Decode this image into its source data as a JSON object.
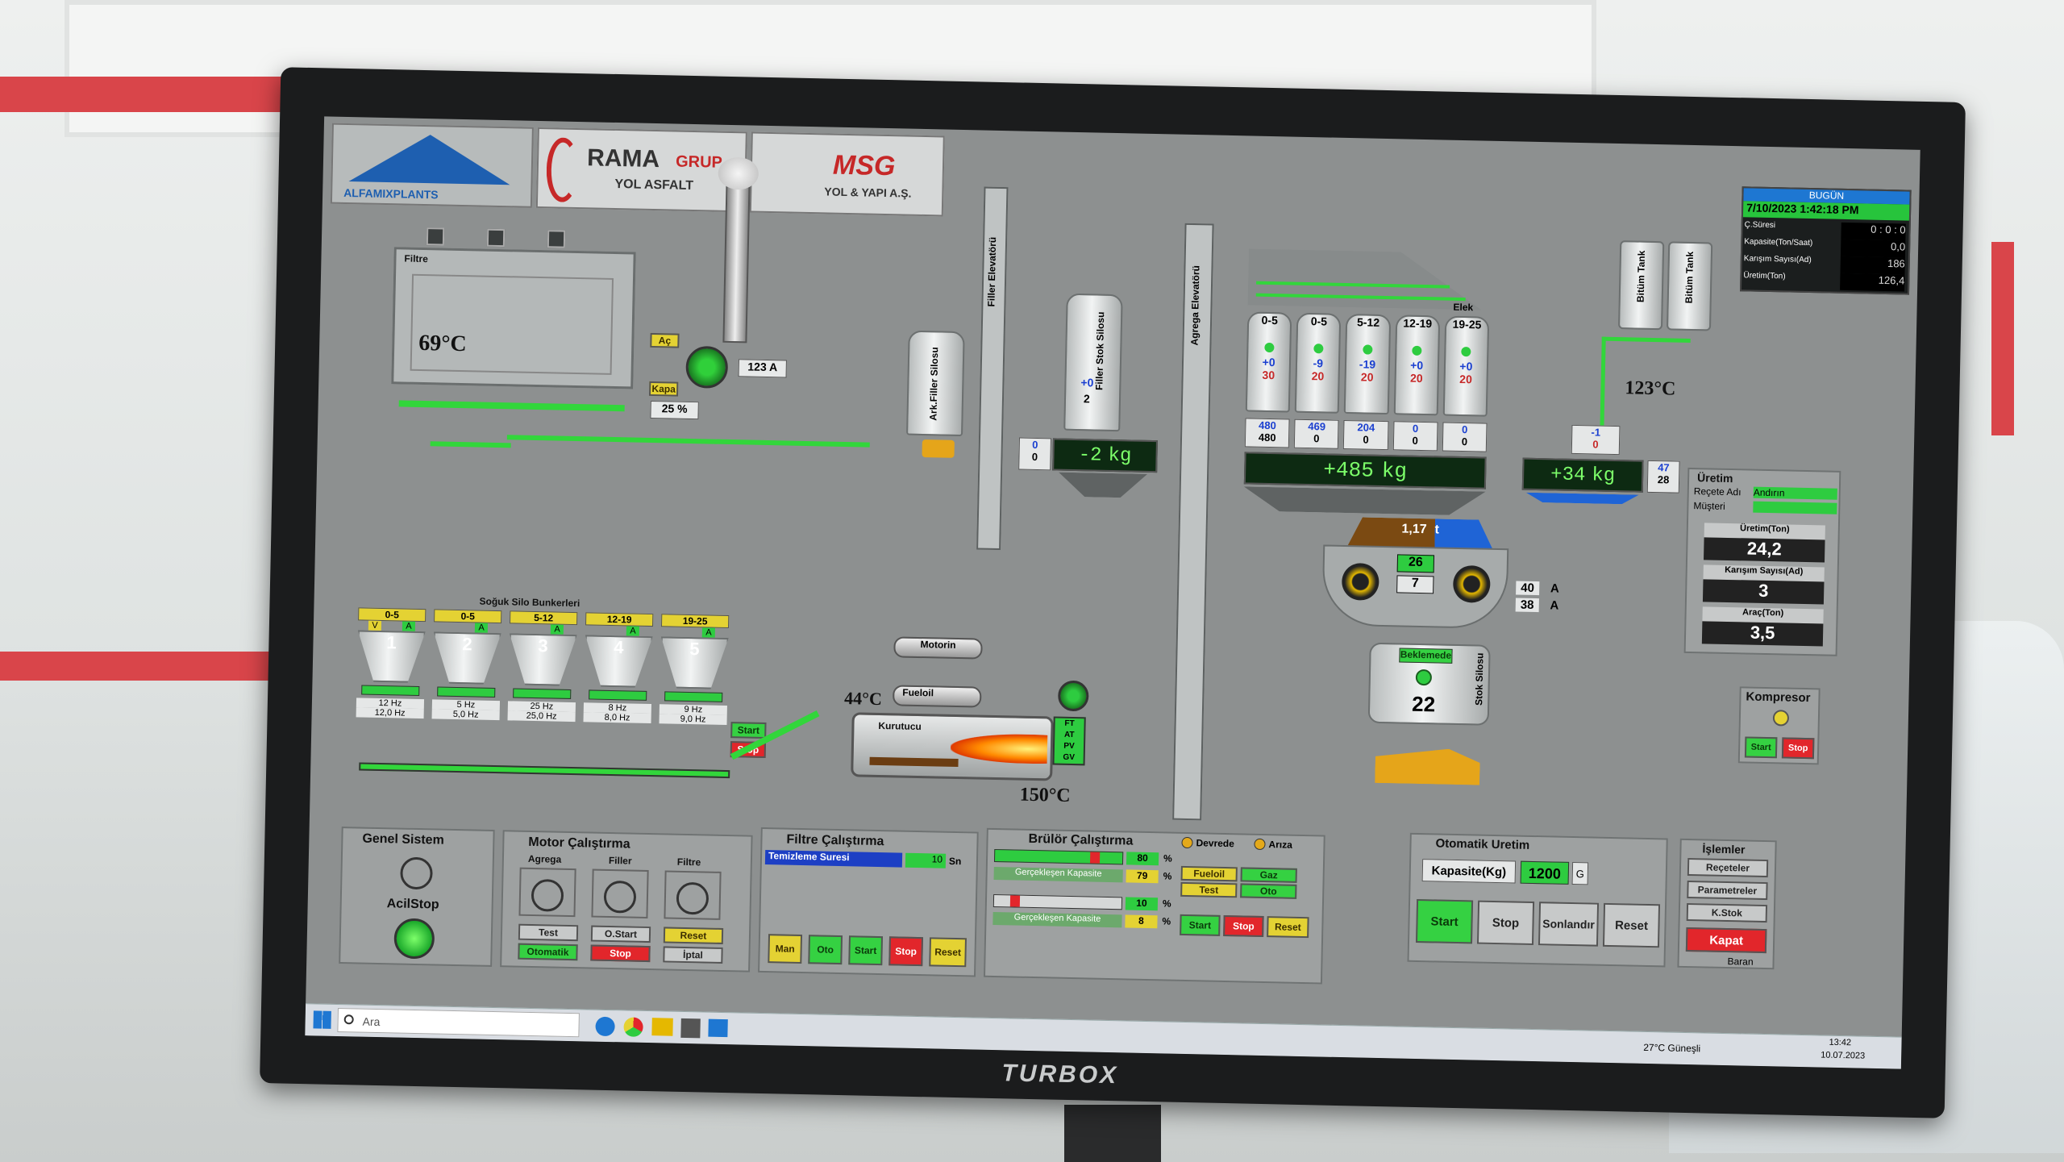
{
  "logos": {
    "alfamix": "ALFAMIXPLANTS",
    "rama": "RAMA",
    "rama_grup": "GRUP",
    "rama_sub": "YOL ASFALT",
    "msg": "MSG",
    "msg_sub": "YOL & YAPI A.Ş."
  },
  "summary": {
    "header": "BUGÜN",
    "datetime": "7/10/2023 1:42:18 PM",
    "rows": [
      {
        "label": "Ç.Süresi",
        "value": "0 : 0 : 0"
      },
      {
        "label": "Kapasite(Ton/Saat)",
        "value": "0,0"
      },
      {
        "label": "Karışım Sayısı(Ad)",
        "value": "186"
      },
      {
        "label": "Üretim(Ton)",
        "value": "126,4"
      }
    ]
  },
  "filter": {
    "label": "Filtre",
    "temp": "69°C"
  },
  "fan": {
    "open": "Aç",
    "close": "Kapa",
    "amps": "123 A",
    "percent": "25 %"
  },
  "elevators": {
    "filler": "Filler Elevatörü",
    "agrega": "Agrega Elevatörü"
  },
  "silos": {
    "ark_filler": "Ark.Filler Silosu",
    "filler_stok": "Filler Stok Silosu",
    "filler_stok_val1": "+0",
    "filler_stok_val2": "2"
  },
  "bitum": {
    "tank1": "Bitüm Tank",
    "tank2": "Bitüm Tank",
    "temp": "123°C",
    "val1": "-1",
    "val2": "0"
  },
  "screen": {
    "label": "Elek"
  },
  "hot_bins": [
    {
      "name": "0-5",
      "top": "+0",
      "bottom": "30",
      "w1": "480",
      "w2": "480"
    },
    {
      "name": "0-5",
      "top": "-9",
      "bottom": "20",
      "w1": "469",
      "w2": "0"
    },
    {
      "name": "5-12",
      "top": "-19",
      "bottom": "20",
      "w1": "204",
      "w2": "0"
    },
    {
      "name": "12-19",
      "top": "+0",
      "bottom": "20",
      "w1": "0",
      "w2": "0"
    },
    {
      "name": "19-25",
      "top": "+0",
      "bottom": "20",
      "w1": "0",
      "w2": "0"
    }
  ],
  "scales": {
    "filler": {
      "value": "-2",
      "unit": "kg",
      "left1": "0",
      "left2": "0"
    },
    "agrega": {
      "value": "+485",
      "unit": "kg"
    },
    "bitum": {
      "value": "+34",
      "unit": "kg",
      "right1": "47",
      "right2": "28"
    }
  },
  "mixer": {
    "load": "1,17",
    "unit": "t",
    "count_a": "26",
    "count_b": "7",
    "amp1": "40",
    "amp2": "38",
    "a_unit": "A"
  },
  "stok_silo": {
    "status": "Beklemede",
    "value": "22",
    "label": "Stok Silosu"
  },
  "cold_bins": {
    "title": "Soğuk Silo Bunkerleri",
    "bins": [
      {
        "num": "1",
        "size": "0-5",
        "hz1": "12 Hz",
        "hz2": "12,0 Hz",
        "flag": "V",
        "flag2": "A"
      },
      {
        "num": "2",
        "size": "0-5",
        "hz1": "5 Hz",
        "hz2": "5,0 Hz",
        "flag": "",
        "flag2": "A"
      },
      {
        "num": "3",
        "size": "5-12",
        "hz1": "25 Hz",
        "hz2": "25,0 Hz",
        "flag": "",
        "flag2": "A"
      },
      {
        "num": "4",
        "size": "12-19",
        "hz1": "8 Hz",
        "hz2": "8,0 Hz",
        "flag": "",
        "flag2": "A"
      },
      {
        "num": "5",
        "size": "19-25",
        "hz1": "9 Hz",
        "hz2": "9,0 Hz",
        "flag": "",
        "flag2": "A"
      }
    ],
    "start": "Start",
    "stop": "Stop"
  },
  "dryer": {
    "label": "Kurutucu",
    "motor": "Motorin",
    "fuel": "Fueloil",
    "temp_in": "44°C",
    "temp_out": "150°C",
    "indicators": [
      "FT",
      "AT",
      "PV",
      "GV"
    ]
  },
  "production": {
    "title": "Üretim",
    "recipe_label": "Reçete Adı",
    "recipe_value": "Andırın",
    "customer_label": "Müşteri",
    "customer_value": "",
    "prod_label": "Üretim(Ton)",
    "prod_value": "24,2",
    "mix_label": "Karışım Sayısı(Ad)",
    "mix_value": "3",
    "vehicle_label": "Araç(Ton)",
    "vehicle_value": "3,5"
  },
  "compressor": {
    "title": "Kompresor",
    "start": "Start",
    "stop": "Stop"
  },
  "genel": {
    "title": "Genel Sistem",
    "acil": "AcilStop"
  },
  "motor": {
    "title": "Motor Çalıştırma",
    "agrega": "Agrega",
    "filler": "Filler",
    "filtre": "Filtre",
    "test": "Test",
    "ostart": "O.Start",
    "reset": "Reset",
    "otomatik": "Otomatik",
    "stop": "Stop",
    "iptal": "İptal"
  },
  "filtre_cal": {
    "title": "Filtre Çalıştırma",
    "temizleme": "Temizleme Suresi",
    "value": "10",
    "unit": "Sn",
    "man": "Man",
    "oto": "Oto",
    "start": "Start",
    "stop": "Stop",
    "reset": "Reset"
  },
  "brulor": {
    "title": "Brülör Çalıştırma",
    "val1": "80",
    "val2": "79",
    "val3": "10",
    "val4": "8",
    "pct": "%",
    "gercek": "Gerçekleşen Kapasite",
    "devrede": "Devrede",
    "ariza": "Arıza",
    "fueloil": "Fueloil",
    "gaz": "Gaz",
    "test": "Test",
    "oto": "Oto",
    "start": "Start",
    "stop": "Stop",
    "reset": "Reset"
  },
  "otomatik": {
    "title": "Otomatik Uretim",
    "kapasite_label": "Kapasite(Kg)",
    "kapasite_value": "1200",
    "unit": "G",
    "start": "Start",
    "stop": "Stop",
    "sonlandir": "Sonlandır",
    "reset": "Reset"
  },
  "islemler": {
    "title": "İşlemler",
    "receteler": "Reçeteler",
    "parametreler": "Parametreler",
    "kstok": "K.Stok",
    "kapat": "Kapat",
    "baran": "Baran"
  },
  "taskbar": {
    "search": "Ara",
    "weather": "27°C Güneşli",
    "time": "13:42",
    "date": "10.07.2023"
  },
  "monitor_brand": "TURBOX",
  "colors": {
    "accent_green": "#2ecc40",
    "stop_red": "#e2262b",
    "reset_yellow": "#e4d233",
    "panel_grey": "#9ea1a1"
  }
}
